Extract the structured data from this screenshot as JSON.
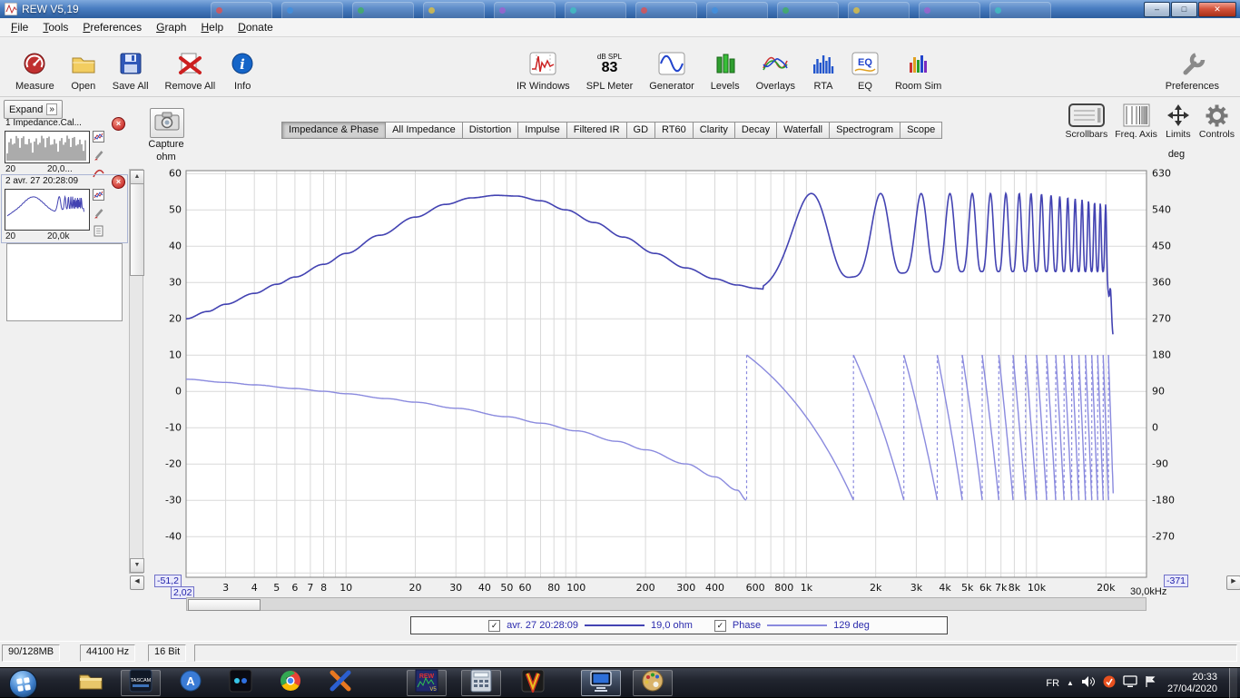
{
  "window": {
    "title": "REW V5,19",
    "controls": [
      "minimize",
      "maximize",
      "close"
    ]
  },
  "menu": [
    "File",
    "Tools",
    "Preferences",
    "Graph",
    "Help",
    "Donate"
  ],
  "toolbar": {
    "left": [
      {
        "label": "Measure",
        "icon": "gauge-icon"
      },
      {
        "label": "Open",
        "icon": "folder-icon"
      },
      {
        "label": "Save All",
        "icon": "floppy-icon"
      },
      {
        "label": "Remove All",
        "icon": "remove-icon"
      },
      {
        "label": "Info",
        "icon": "info-icon"
      }
    ],
    "center": [
      {
        "label": "IR Windows",
        "icon": "ir-wave-icon"
      },
      {
        "label": "SPL Meter",
        "icon": "spl-readout",
        "spl_top": "dB SPL",
        "spl_value": "83"
      },
      {
        "label": "Generator",
        "icon": "sine-icon"
      },
      {
        "label": "Levels",
        "icon": "levels-icon"
      },
      {
        "label": "Overlays",
        "icon": "overlays-icon"
      },
      {
        "label": "RTA",
        "icon": "rta-bars-icon"
      },
      {
        "label": "EQ",
        "icon": "eq-icon"
      },
      {
        "label": "Room Sim",
        "icon": "roomsim-icon"
      }
    ],
    "right": [
      {
        "label": "Preferences",
        "icon": "wrench-icon"
      }
    ]
  },
  "sidebar": {
    "expand_label": "Expand",
    "measurements": [
      {
        "title": "1 Impedance.Cal...",
        "range_left": "20",
        "range_right": "20,0...",
        "thumb": "spectrum",
        "selected": false,
        "icons": [
          "mini-chart-icon",
          "pencil-icon",
          "trace-icon"
        ]
      },
      {
        "title": "2 avr. 27 20:28:09",
        "range_left": "20",
        "range_right": "20,0k",
        "thumb": "impedance",
        "selected": true,
        "icons": [
          "mini-chart-icon",
          "pencil-icon",
          "notes-icon"
        ]
      }
    ]
  },
  "capture": {
    "label": "Capture"
  },
  "graph_tabs": {
    "selected": 0,
    "tabs": [
      "Impedance & Phase",
      "All Impedance",
      "Distortion",
      "Impulse",
      "Filtered IR",
      "GD",
      "RT60",
      "Clarity",
      "Decay",
      "Waterfall",
      "Spectrogram",
      "Scope"
    ]
  },
  "graph_tools": [
    {
      "label": "Scrollbars",
      "icon": "scrollbars-icon"
    },
    {
      "label": "Freq. Axis",
      "icon": "freq-axis-icon"
    },
    {
      "label": "Limits",
      "icon": "limits-icon"
    },
    {
      "label": "Controls",
      "icon": "gear-icon"
    }
  ],
  "chart_data": {
    "type": "line",
    "title": "Impedance & Phase",
    "grid": true,
    "x_axis": {
      "scale": "log",
      "min_hz": 2.02,
      "max_hz": 30000,
      "start_label": "2,02",
      "end_label": "30,0kHz",
      "tick_freqs": [
        3,
        4,
        5,
        6,
        7,
        8,
        10,
        20,
        30,
        40,
        50,
        60,
        80,
        100,
        200,
        300,
        400,
        600,
        800,
        1000,
        2000,
        3000,
        4000,
        5000,
        6000,
        7000,
        8000,
        10000,
        20000
      ],
      "tick_labels": [
        "3",
        "4",
        "5",
        "6",
        "7",
        "8",
        "10",
        "20",
        "30",
        "40",
        "50",
        "60",
        "80",
        "100",
        "200",
        "300",
        "400",
        "600",
        "800",
        "1k",
        "2k",
        "3k",
        "4k",
        "5k",
        "6k",
        "7k",
        "8k",
        "10k",
        "20k"
      ]
    },
    "left_axis": {
      "unit": "ohm",
      "min": -51.2,
      "max": 60.8,
      "min_label": "-51,2",
      "ticks": [
        60,
        50,
        40,
        30,
        20,
        10,
        0,
        -10,
        -20,
        -30,
        -40
      ]
    },
    "right_axis": {
      "unit": "deg",
      "min": -371,
      "max": 637,
      "min_label": "-371",
      "ticks": [
        630,
        540,
        450,
        360,
        270,
        180,
        90,
        0,
        -90,
        -180,
        -270
      ]
    },
    "impedance": {
      "color": "#4343b2",
      "low_freq_points": [
        [
          2.02,
          20
        ],
        [
          2.5,
          22
        ],
        [
          3,
          24
        ],
        [
          4,
          27
        ],
        [
          5,
          29.5
        ],
        [
          6,
          31.5
        ],
        [
          8,
          35
        ],
        [
          10,
          38
        ],
        [
          14,
          43
        ],
        [
          20,
          48
        ],
        [
          27,
          51.5
        ],
        [
          35,
          53.3
        ],
        [
          45,
          54
        ],
        [
          55,
          53.8
        ],
        [
          70,
          52.5
        ],
        [
          90,
          50
        ],
        [
          120,
          46.5
        ],
        [
          160,
          42.5
        ],
        [
          220,
          38
        ],
        [
          300,
          34
        ],
        [
          400,
          31
        ],
        [
          500,
          29.3
        ],
        [
          600,
          28.4
        ],
        [
          650,
          28.2
        ]
      ],
      "ripple": {
        "start_hz": 650,
        "spacing_hz": 1050,
        "peak_ohm": 54.5,
        "valley_base_ohm": 33,
        "valley_dip": 4.8,
        "valley_tau_hz": 800,
        "peak_drop_above_hz": 10000,
        "peak_drop_per_10k": 3.0,
        "sharpness": 1.7
      },
      "end": {
        "fade_start_hz": 20000,
        "end_hz": 21500,
        "end_ohm": 15
      }
    },
    "phase": {
      "color": "#8a8ade",
      "low_freq_points": [
        [
          2.02,
          120
        ],
        [
          3,
          112
        ],
        [
          4,
          106
        ],
        [
          6,
          97
        ],
        [
          8,
          90
        ],
        [
          10,
          84
        ],
        [
          15,
          72
        ],
        [
          20,
          63
        ],
        [
          30,
          48
        ],
        [
          50,
          27
        ],
        [
          70,
          11
        ],
        [
          100,
          -8
        ],
        [
          150,
          -34
        ],
        [
          200,
          -55
        ],
        [
          300,
          -90
        ],
        [
          400,
          -122
        ],
        [
          500,
          -155
        ],
        [
          550,
          -180
        ]
      ],
      "wrap_start_hz": 550,
      "wrap_spacing_hz": 1050,
      "end_hz": 21500,
      "wrap_top_deg": 180,
      "wrap_bottom_deg": -180
    }
  },
  "legend": {
    "series": [
      {
        "checked": true,
        "label": "avr. 27 20:28:09",
        "value": "19,0 ohm"
      },
      {
        "checked": true,
        "label": "Phase",
        "value": "129 deg"
      }
    ]
  },
  "statusbar": {
    "panels": [
      "90/128MB",
      "44100 Hz",
      "16 Bit"
    ]
  },
  "taskbar": {
    "buttons": [
      {
        "name": "explorer",
        "open": false,
        "active": false
      },
      {
        "name": "tascam",
        "open": true,
        "active": false
      },
      {
        "name": "aimp",
        "open": false,
        "active": false
      },
      {
        "name": "dots-app",
        "open": false,
        "active": false
      },
      {
        "name": "chrome",
        "open": false,
        "active": false
      },
      {
        "name": "x-app",
        "open": false,
        "active": false
      },
      {
        "name": "rew",
        "open": true,
        "active": false
      },
      {
        "name": "calculator",
        "open": true,
        "active": false
      },
      {
        "name": "v-app",
        "open": false,
        "active": false
      },
      {
        "name": "display",
        "open": true,
        "active": true
      },
      {
        "name": "paint",
        "open": true,
        "active": false
      }
    ],
    "tray": {
      "lang": "FR",
      "time": "20:33",
      "date": "27/04/2020"
    }
  }
}
